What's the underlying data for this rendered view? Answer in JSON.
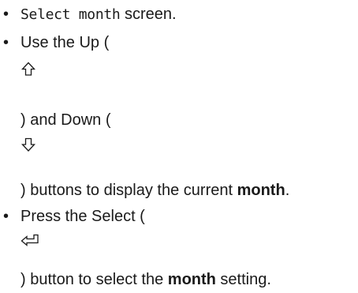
{
  "doc": {
    "item1": {
      "code": "Select month",
      "rest": " screen."
    },
    "item2": {
      "line1": "Use the Up (",
      "icon1": "up-arrow-icon",
      "line2": ") and Down (",
      "icon2": "down-arrow-icon",
      "line3_prefix": ") buttons to display the current ",
      "line3_bold": "month",
      "line3_suffix": "."
    },
    "item3": {
      "line1": "Press the Select (",
      "icon": "enter-key-icon",
      "line2_prefix": ") button to select the ",
      "line2_bold": "month",
      "line2_suffix": " setting."
    }
  }
}
